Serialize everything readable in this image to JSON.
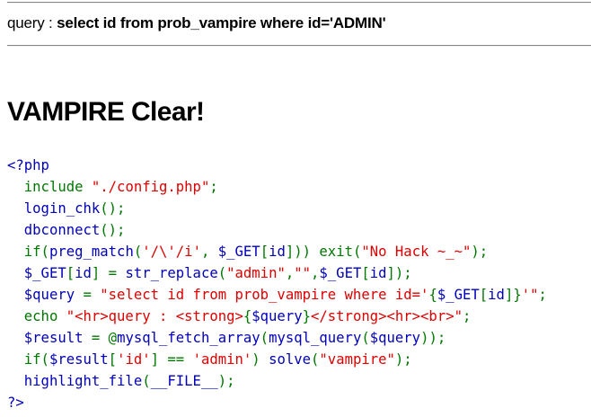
{
  "header": {
    "query_label": "query : ",
    "query_value": "select id from prob_vampire where id='ADMIN'"
  },
  "result": {
    "title": "VAMPIRE Clear!"
  },
  "source": {
    "lines": [
      [
        {
          "t": "<?php",
          "c": "default"
        }
      ],
      [
        {
          "t": "  include ",
          "c": "keyword"
        },
        {
          "t": "\"./config.php\"",
          "c": "string"
        },
        {
          "t": ";",
          "c": "keyword"
        }
      ],
      [
        {
          "t": "  login_chk",
          "c": "default"
        },
        {
          "t": "();",
          "c": "keyword"
        }
      ],
      [
        {
          "t": "  dbconnect",
          "c": "default"
        },
        {
          "t": "();",
          "c": "keyword"
        }
      ],
      [
        {
          "t": "  if(",
          "c": "keyword"
        },
        {
          "t": "preg_match",
          "c": "default"
        },
        {
          "t": "(",
          "c": "keyword"
        },
        {
          "t": "'/\\'/i'",
          "c": "string"
        },
        {
          "t": ", ",
          "c": "keyword"
        },
        {
          "t": "$_GET",
          "c": "default"
        },
        {
          "t": "[",
          "c": "keyword"
        },
        {
          "t": "id",
          "c": "default"
        },
        {
          "t": "])) exit(",
          "c": "keyword"
        },
        {
          "t": "\"No Hack ~_~\"",
          "c": "string"
        },
        {
          "t": ");",
          "c": "keyword"
        }
      ],
      [
        {
          "t": "  $_GET",
          "c": "default"
        },
        {
          "t": "[",
          "c": "keyword"
        },
        {
          "t": "id",
          "c": "default"
        },
        {
          "t": "] = ",
          "c": "keyword"
        },
        {
          "t": "str_replace",
          "c": "default"
        },
        {
          "t": "(",
          "c": "keyword"
        },
        {
          "t": "\"admin\"",
          "c": "string"
        },
        {
          "t": ",",
          "c": "keyword"
        },
        {
          "t": "\"\"",
          "c": "string"
        },
        {
          "t": ",",
          "c": "keyword"
        },
        {
          "t": "$_GET",
          "c": "default"
        },
        {
          "t": "[",
          "c": "keyword"
        },
        {
          "t": "id",
          "c": "default"
        },
        {
          "t": "]);",
          "c": "keyword"
        }
      ],
      [
        {
          "t": "  $query ",
          "c": "default"
        },
        {
          "t": "= ",
          "c": "keyword"
        },
        {
          "t": "\"select id from prob_vampire where id='",
          "c": "string"
        },
        {
          "t": "{",
          "c": "keyword"
        },
        {
          "t": "$_GET",
          "c": "default"
        },
        {
          "t": "[",
          "c": "keyword"
        },
        {
          "t": "id",
          "c": "default"
        },
        {
          "t": "]",
          "c": "keyword"
        },
        {
          "t": "}",
          "c": "keyword"
        },
        {
          "t": "'\"",
          "c": "string"
        },
        {
          "t": ";",
          "c": "keyword"
        }
      ],
      [
        {
          "t": "  echo ",
          "c": "keyword"
        },
        {
          "t": "\"<hr>query : <strong>",
          "c": "string"
        },
        {
          "t": "{",
          "c": "keyword"
        },
        {
          "t": "$query",
          "c": "default"
        },
        {
          "t": "}",
          "c": "keyword"
        },
        {
          "t": "</strong><hr><br>\"",
          "c": "string"
        },
        {
          "t": ";",
          "c": "keyword"
        }
      ],
      [
        {
          "t": "  $result ",
          "c": "default"
        },
        {
          "t": "= @",
          "c": "keyword"
        },
        {
          "t": "mysql_fetch_array",
          "c": "default"
        },
        {
          "t": "(",
          "c": "keyword"
        },
        {
          "t": "mysql_query",
          "c": "default"
        },
        {
          "t": "(",
          "c": "keyword"
        },
        {
          "t": "$query",
          "c": "default"
        },
        {
          "t": "));",
          "c": "keyword"
        }
      ],
      [
        {
          "t": "  if(",
          "c": "keyword"
        },
        {
          "t": "$result",
          "c": "default"
        },
        {
          "t": "[",
          "c": "keyword"
        },
        {
          "t": "'id'",
          "c": "string"
        },
        {
          "t": "] == ",
          "c": "keyword"
        },
        {
          "t": "'admin'",
          "c": "string"
        },
        {
          "t": ") ",
          "c": "keyword"
        },
        {
          "t": "solve",
          "c": "default"
        },
        {
          "t": "(",
          "c": "keyword"
        },
        {
          "t": "\"vampire\"",
          "c": "string"
        },
        {
          "t": ");",
          "c": "keyword"
        }
      ],
      [
        {
          "t": "  highlight_file",
          "c": "default"
        },
        {
          "t": "(",
          "c": "keyword"
        },
        {
          "t": "__FILE__",
          "c": "default"
        },
        {
          "t": ");",
          "c": "keyword"
        }
      ],
      [
        {
          "t": "?>",
          "c": "default"
        }
      ]
    ]
  },
  "colors": {
    "default": "#0000BB",
    "keyword": "#007700",
    "string": "#DD0000",
    "hr": "#8a8a8a"
  }
}
